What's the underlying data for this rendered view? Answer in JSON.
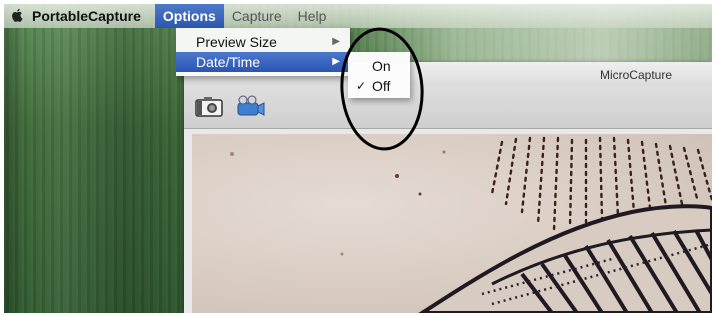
{
  "menubar": {
    "app_name": "PortableCapture",
    "items": [
      {
        "label": "Options"
      },
      {
        "label": "Capture"
      },
      {
        "label": "Help"
      }
    ]
  },
  "options_menu": {
    "items": [
      {
        "label": "Preview Size"
      },
      {
        "label": "Date/Time"
      }
    ]
  },
  "datetime_submenu": {
    "items": [
      {
        "label": "On",
        "checked": false
      },
      {
        "label": "Off",
        "checked": true
      }
    ]
  },
  "window": {
    "title": "MicroCapture",
    "toolbar": [
      {
        "icon": "camera-icon"
      },
      {
        "icon": "video-camera-icon"
      }
    ]
  },
  "colors": {
    "menu_highlight": "#2c57b0",
    "annotation": "#000000"
  }
}
